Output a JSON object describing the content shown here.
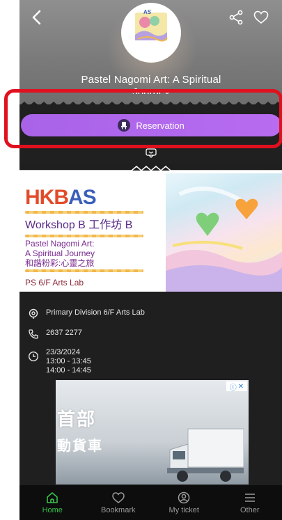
{
  "header": {
    "title_line1": "Pastel Nagomi Art: A Spiritual",
    "title_line2": "Journey"
  },
  "reservation": {
    "label": "Reservation"
  },
  "poster": {
    "logo_left": "HKB",
    "logo_right": "AS",
    "workshop": "Workshop B   工作坊 B",
    "line1": "Pastel Nagomi Art:",
    "line2": "A Spiritual Journey",
    "line3": "和諧粉彩:心靈之旅",
    "location": "PS 6/F Arts Lab"
  },
  "info": {
    "venue": "Primary Division 6/F Arts Lab",
    "phone": "2637 2277",
    "date": "23/3/2024",
    "time1": "13:00 - 13:45",
    "time2": "14:00 - 14:45"
  },
  "ad": {
    "text1": "首部",
    "text2": "動貨車"
  },
  "nav": {
    "items": [
      {
        "label": "Home"
      },
      {
        "label": "Bookmark"
      },
      {
        "label": "My ticket"
      },
      {
        "label": "Other"
      }
    ],
    "active_color": "#36c24a"
  },
  "colors": {
    "reservation_gradient": [
      "#a863e8",
      "#b86cf0"
    ],
    "highlight_frame": "#e0101e",
    "background": "#1f1f1f"
  }
}
